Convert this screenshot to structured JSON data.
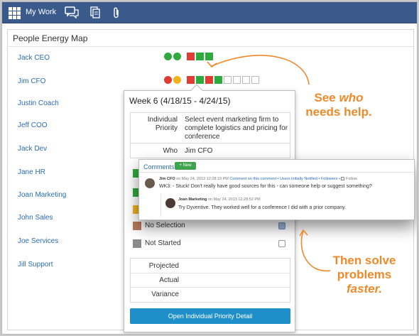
{
  "topbar": {
    "my_work": "My Work",
    "icons": [
      "apps-grid-icon",
      "chat-icon",
      "documents-icon",
      "attachment-icon"
    ]
  },
  "panel": {
    "title": "People Energy Map"
  },
  "people": [
    "Jack CEO",
    "Jim CFO",
    "Justin Coach",
    "Jeff COO",
    "Jack Dev",
    "Jane HR",
    "Joan Marketing",
    "John Sales",
    "Joe Services",
    "Jill Support"
  ],
  "energy": {
    "jack_ceo": {
      "dots": [
        "#2eab3c",
        "#2eab3c"
      ],
      "squares": [
        "#e03c31",
        "#2eab3c",
        "#2eab3c"
      ]
    },
    "jim_cfo": {
      "dots": [
        "#e03c31",
        "#f2b21b"
      ],
      "squares": [
        "#e03c31",
        "#2eab3c",
        "#e03c31",
        "#2eab3c",
        "empty",
        "empty",
        "empty",
        "empty"
      ]
    }
  },
  "popover": {
    "week": "Week 6 (4/18/15 - 4/24/15)",
    "priority_label": "Individual Priority",
    "priority_value": "Select event marketing firm to complete logistics and pricing for conference",
    "who_label": "Who",
    "who_value": "Jim CFO",
    "statuses": [
      {
        "label": "No Selection",
        "color": "#b97b5b",
        "checked": true
      },
      {
        "label": "Not Started",
        "color": "#8a8a8a",
        "checked": false
      }
    ],
    "metrics": [
      "Projected",
      "Actual",
      "Variance"
    ],
    "open_button": "Open Individual Priority Detail"
  },
  "comments": {
    "header": "Comments",
    "new_button": "+ New",
    "comment1": {
      "author": "Jim CFO",
      "meta": "on May 24, 2013 12:28:19 PM",
      "links": "Comment on this comment • Users Initially Notified • Followers •",
      "follow": "Follow",
      "text": "WK3: - Stuck! Don't really have good sources for this - can someone help or suggest something?"
    },
    "comment2": {
      "author": "Joan Marketing",
      "meta": "on May 24, 2013 12:28:52 PM",
      "text": "Try Dyventive. They worked well for a conference I did with a prior company."
    }
  },
  "callouts": {
    "see": "See",
    "who": "who",
    "needs_help": "needs help.",
    "then_solve": "Then solve",
    "problems": "problems",
    "faster": "faster."
  },
  "colors": {
    "topbar": "#3a5a8c",
    "link": "#2a6db5",
    "green": "#2eab3c",
    "red": "#e03c31",
    "yellow": "#f2b21b",
    "callout": "#ee8a2a",
    "button": "#1e8fc8"
  }
}
